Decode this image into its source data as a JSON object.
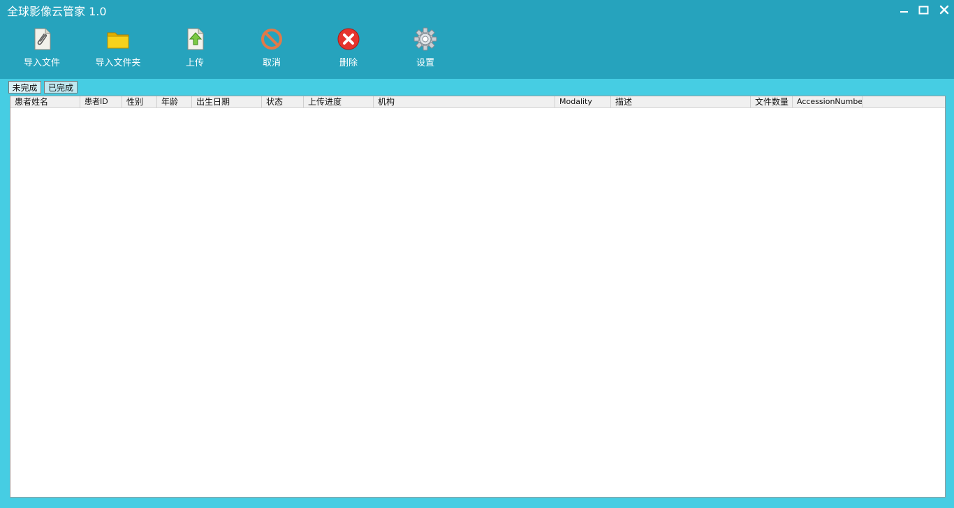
{
  "window": {
    "title": "全球影像云管家 1.0"
  },
  "toolbar": {
    "items": [
      {
        "label": "导入文件",
        "icon": "paperclip-document-icon"
      },
      {
        "label": "导入文件夹",
        "icon": "folder-icon"
      },
      {
        "label": "上传",
        "icon": "upload-arrow-icon"
      },
      {
        "label": "取消",
        "icon": "cancel-icon"
      },
      {
        "label": "删除",
        "icon": "delete-icon"
      },
      {
        "label": "设置",
        "icon": "gear-icon"
      }
    ]
  },
  "tabs": [
    {
      "label": "未完成"
    },
    {
      "label": "已完成"
    }
  ],
  "table": {
    "columns": [
      "患者姓名",
      "患者ID",
      "性别",
      "年龄",
      "出生日期",
      "状态",
      "上传进度",
      "机构",
      "Modality",
      "描述",
      "文件数量",
      "AccessionNumber"
    ],
    "rows": []
  },
  "colors": {
    "titlebar": "#26a3bd",
    "background": "#46cde3"
  }
}
